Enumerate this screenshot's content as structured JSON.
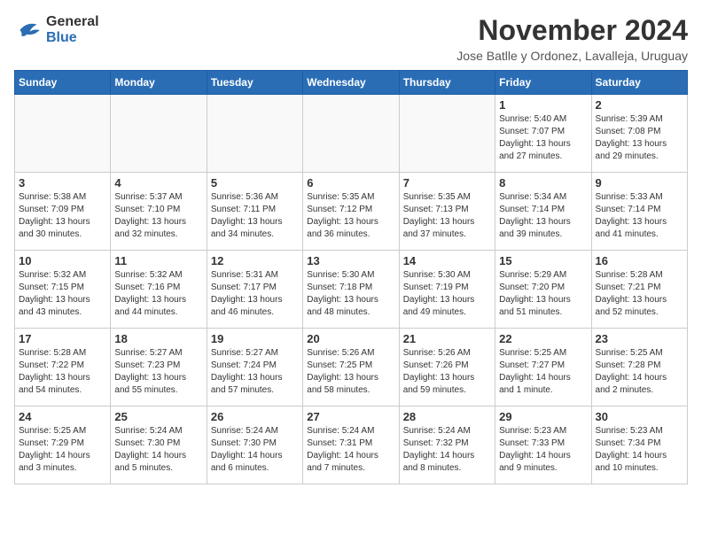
{
  "header": {
    "logo_general": "General",
    "logo_blue": "Blue",
    "month_title": "November 2024",
    "subtitle": "Jose Batlle y Ordonez, Lavalleja, Uruguay"
  },
  "days_of_week": [
    "Sunday",
    "Monday",
    "Tuesday",
    "Wednesday",
    "Thursday",
    "Friday",
    "Saturday"
  ],
  "weeks": [
    [
      {
        "day": "",
        "info": ""
      },
      {
        "day": "",
        "info": ""
      },
      {
        "day": "",
        "info": ""
      },
      {
        "day": "",
        "info": ""
      },
      {
        "day": "",
        "info": ""
      },
      {
        "day": "1",
        "info": "Sunrise: 5:40 AM\nSunset: 7:07 PM\nDaylight: 13 hours and 27 minutes."
      },
      {
        "day": "2",
        "info": "Sunrise: 5:39 AM\nSunset: 7:08 PM\nDaylight: 13 hours and 29 minutes."
      }
    ],
    [
      {
        "day": "3",
        "info": "Sunrise: 5:38 AM\nSunset: 7:09 PM\nDaylight: 13 hours and 30 minutes."
      },
      {
        "day": "4",
        "info": "Sunrise: 5:37 AM\nSunset: 7:10 PM\nDaylight: 13 hours and 32 minutes."
      },
      {
        "day": "5",
        "info": "Sunrise: 5:36 AM\nSunset: 7:11 PM\nDaylight: 13 hours and 34 minutes."
      },
      {
        "day": "6",
        "info": "Sunrise: 5:35 AM\nSunset: 7:12 PM\nDaylight: 13 hours and 36 minutes."
      },
      {
        "day": "7",
        "info": "Sunrise: 5:35 AM\nSunset: 7:13 PM\nDaylight: 13 hours and 37 minutes."
      },
      {
        "day": "8",
        "info": "Sunrise: 5:34 AM\nSunset: 7:14 PM\nDaylight: 13 hours and 39 minutes."
      },
      {
        "day": "9",
        "info": "Sunrise: 5:33 AM\nSunset: 7:14 PM\nDaylight: 13 hours and 41 minutes."
      }
    ],
    [
      {
        "day": "10",
        "info": "Sunrise: 5:32 AM\nSunset: 7:15 PM\nDaylight: 13 hours and 43 minutes."
      },
      {
        "day": "11",
        "info": "Sunrise: 5:32 AM\nSunset: 7:16 PM\nDaylight: 13 hours and 44 minutes."
      },
      {
        "day": "12",
        "info": "Sunrise: 5:31 AM\nSunset: 7:17 PM\nDaylight: 13 hours and 46 minutes."
      },
      {
        "day": "13",
        "info": "Sunrise: 5:30 AM\nSunset: 7:18 PM\nDaylight: 13 hours and 48 minutes."
      },
      {
        "day": "14",
        "info": "Sunrise: 5:30 AM\nSunset: 7:19 PM\nDaylight: 13 hours and 49 minutes."
      },
      {
        "day": "15",
        "info": "Sunrise: 5:29 AM\nSunset: 7:20 PM\nDaylight: 13 hours and 51 minutes."
      },
      {
        "day": "16",
        "info": "Sunrise: 5:28 AM\nSunset: 7:21 PM\nDaylight: 13 hours and 52 minutes."
      }
    ],
    [
      {
        "day": "17",
        "info": "Sunrise: 5:28 AM\nSunset: 7:22 PM\nDaylight: 13 hours and 54 minutes."
      },
      {
        "day": "18",
        "info": "Sunrise: 5:27 AM\nSunset: 7:23 PM\nDaylight: 13 hours and 55 minutes."
      },
      {
        "day": "19",
        "info": "Sunrise: 5:27 AM\nSunset: 7:24 PM\nDaylight: 13 hours and 57 minutes."
      },
      {
        "day": "20",
        "info": "Sunrise: 5:26 AM\nSunset: 7:25 PM\nDaylight: 13 hours and 58 minutes."
      },
      {
        "day": "21",
        "info": "Sunrise: 5:26 AM\nSunset: 7:26 PM\nDaylight: 13 hours and 59 minutes."
      },
      {
        "day": "22",
        "info": "Sunrise: 5:25 AM\nSunset: 7:27 PM\nDaylight: 14 hours and 1 minute."
      },
      {
        "day": "23",
        "info": "Sunrise: 5:25 AM\nSunset: 7:28 PM\nDaylight: 14 hours and 2 minutes."
      }
    ],
    [
      {
        "day": "24",
        "info": "Sunrise: 5:25 AM\nSunset: 7:29 PM\nDaylight: 14 hours and 3 minutes."
      },
      {
        "day": "25",
        "info": "Sunrise: 5:24 AM\nSunset: 7:30 PM\nDaylight: 14 hours and 5 minutes."
      },
      {
        "day": "26",
        "info": "Sunrise: 5:24 AM\nSunset: 7:30 PM\nDaylight: 14 hours and 6 minutes."
      },
      {
        "day": "27",
        "info": "Sunrise: 5:24 AM\nSunset: 7:31 PM\nDaylight: 14 hours and 7 minutes."
      },
      {
        "day": "28",
        "info": "Sunrise: 5:24 AM\nSunset: 7:32 PM\nDaylight: 14 hours and 8 minutes."
      },
      {
        "day": "29",
        "info": "Sunrise: 5:23 AM\nSunset: 7:33 PM\nDaylight: 14 hours and 9 minutes."
      },
      {
        "day": "30",
        "info": "Sunrise: 5:23 AM\nSunset: 7:34 PM\nDaylight: 14 hours and 10 minutes."
      }
    ]
  ],
  "colors": {
    "header_bg": "#2a6db5",
    "header_text": "#ffffff",
    "border": "#cccccc"
  }
}
